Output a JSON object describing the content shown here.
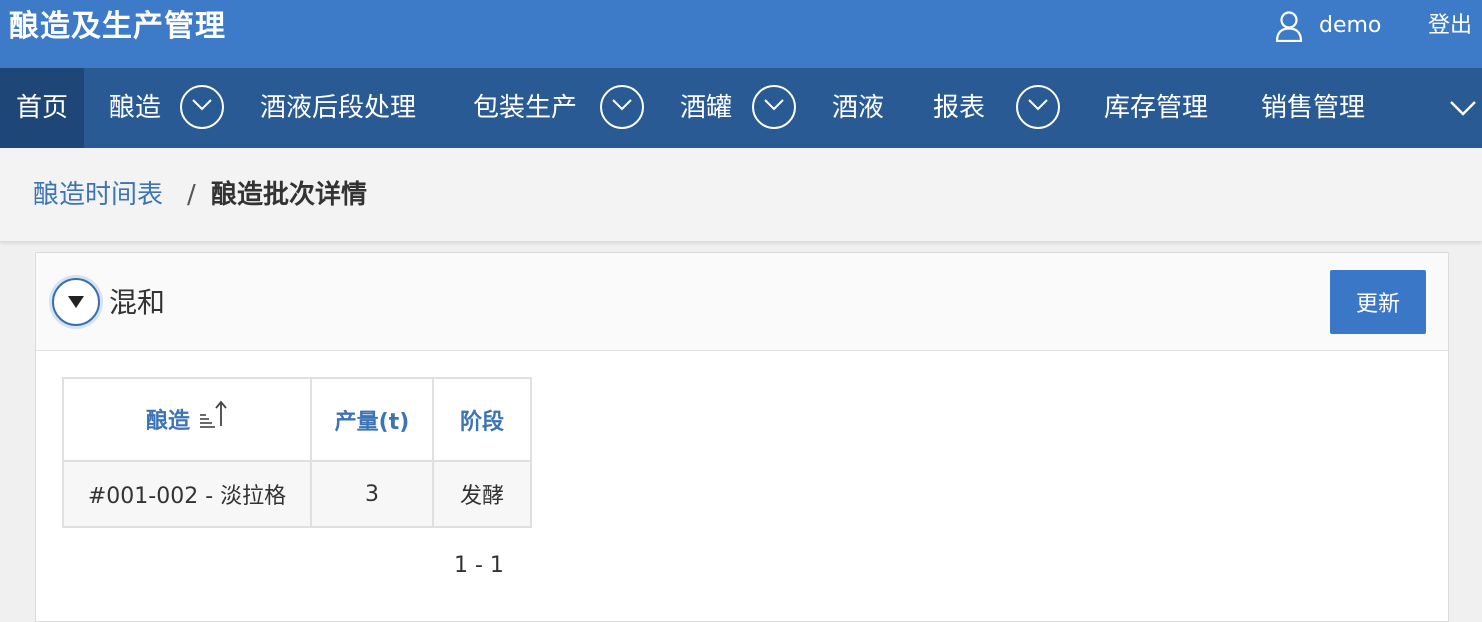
{
  "header": {
    "app_title": "酿造及生产管理",
    "user_name": "demo",
    "logout_label": "登出"
  },
  "nav": {
    "items": [
      {
        "label": "首页",
        "active": true,
        "has_submenu": false
      },
      {
        "label": "酿造",
        "active": false,
        "has_submenu": true
      },
      {
        "label": "酒液后段处理",
        "active": false,
        "has_submenu": false
      },
      {
        "label": "包装生产",
        "active": false,
        "has_submenu": true
      },
      {
        "label": "酒罐",
        "active": false,
        "has_submenu": true
      },
      {
        "label": "酒液",
        "active": false,
        "has_submenu": false
      },
      {
        "label": "报表",
        "active": false,
        "has_submenu": true
      },
      {
        "label": "库存管理",
        "active": false,
        "has_submenu": false
      },
      {
        "label": "销售管理",
        "active": false,
        "has_submenu": false
      }
    ],
    "more_icon": "chevron-down-icon"
  },
  "breadcrumb": {
    "parent": "酿造时间表",
    "separator": "/",
    "current": "酿造批次详情"
  },
  "region": {
    "title": "混和",
    "update_button": "更新",
    "table": {
      "columns": [
        "酿造",
        "产量(t)",
        "阶段"
      ],
      "sort_column": "酿造",
      "sort_direction": "ascending",
      "rows": [
        [
          "#001-002 - 淡拉格",
          "3",
          "发酵"
        ]
      ]
    },
    "pagination": "1 - 1"
  },
  "colors": {
    "header_bg": "#3d7bc9",
    "nav_bg": "#2a5a93",
    "nav_active_bg": "#1e4677",
    "link": "#3d74b6",
    "button_bg": "#3a77c6"
  }
}
